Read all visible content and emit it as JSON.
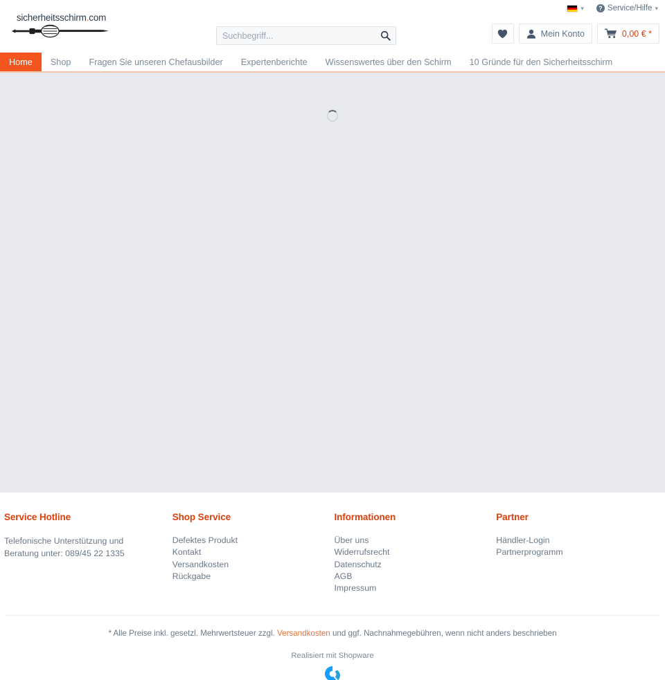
{
  "topbar": {
    "language": {
      "icon": "german-flag-icon",
      "label": "",
      "chevron": "⌄"
    },
    "service": {
      "icon": "question-circle-icon",
      "label": "Service/Hilfe",
      "chevron": "⌄"
    }
  },
  "header": {
    "logo": {
      "text": "sicherheitsschirm",
      "dot": ".",
      "tld": "com",
      "image_alt": "hand-gripping-umbrella-logo"
    },
    "search": {
      "placeholder": "Suchbegriff...",
      "value": "",
      "button_icon": "search-icon"
    },
    "actions": {
      "wishlist": {
        "icon": "heart-icon",
        "label": ""
      },
      "account": {
        "icon": "user-icon",
        "label": "Mein Konto"
      },
      "cart": {
        "icon": "cart-icon",
        "label": "0,00 € *"
      }
    }
  },
  "nav": {
    "items": [
      {
        "label": "Home",
        "active": true
      },
      {
        "label": "Shop",
        "active": false
      },
      {
        "label": "Fragen Sie unseren Chefausbilder",
        "active": false
      },
      {
        "label": "Expertenberichte",
        "active": false
      },
      {
        "label": "Wissenswertes über den Schirm",
        "active": false
      },
      {
        "label": "10 Gründe für den Sicherheitsschirm",
        "active": false
      }
    ]
  },
  "content": {
    "state": "loading",
    "spinner_name": "loading-spinner"
  },
  "footer": {
    "columns": [
      {
        "title": "Service Hotline",
        "paragraph": "Telefonische Unterstützung und Beratung unter: 089/45 22 1335",
        "links": []
      },
      {
        "title": "Shop Service",
        "paragraph": "",
        "links": [
          "Defektes Produkt",
          "Kontakt",
          "Versandkosten",
          "Rückgabe"
        ]
      },
      {
        "title": "Informationen",
        "paragraph": "",
        "links": [
          "Über uns",
          "Widerrufsrecht",
          "Datenschutz",
          "AGB",
          "Impressum"
        ]
      },
      {
        "title": "Partner",
        "paragraph": "",
        "links": [
          "Händler-Login",
          "Partnerprogramm"
        ]
      }
    ],
    "legal": {
      "before": "* Alle Preise inkl. gesetzl. Mehrwertsteuer zzgl. ",
      "link": "Versandkosten",
      "after": " und ggf. Nachnahmegebühren, wenn nicht anders beschrieben"
    },
    "powered_by": "Realisiert mit Shopware",
    "shopware_logo_name": "shopware-logo"
  },
  "colors": {
    "accent": "#f4541d",
    "heading": "#d9400b",
    "link": "#e8703a",
    "content_bg": "#e8eaee",
    "text": "#6a7887"
  }
}
